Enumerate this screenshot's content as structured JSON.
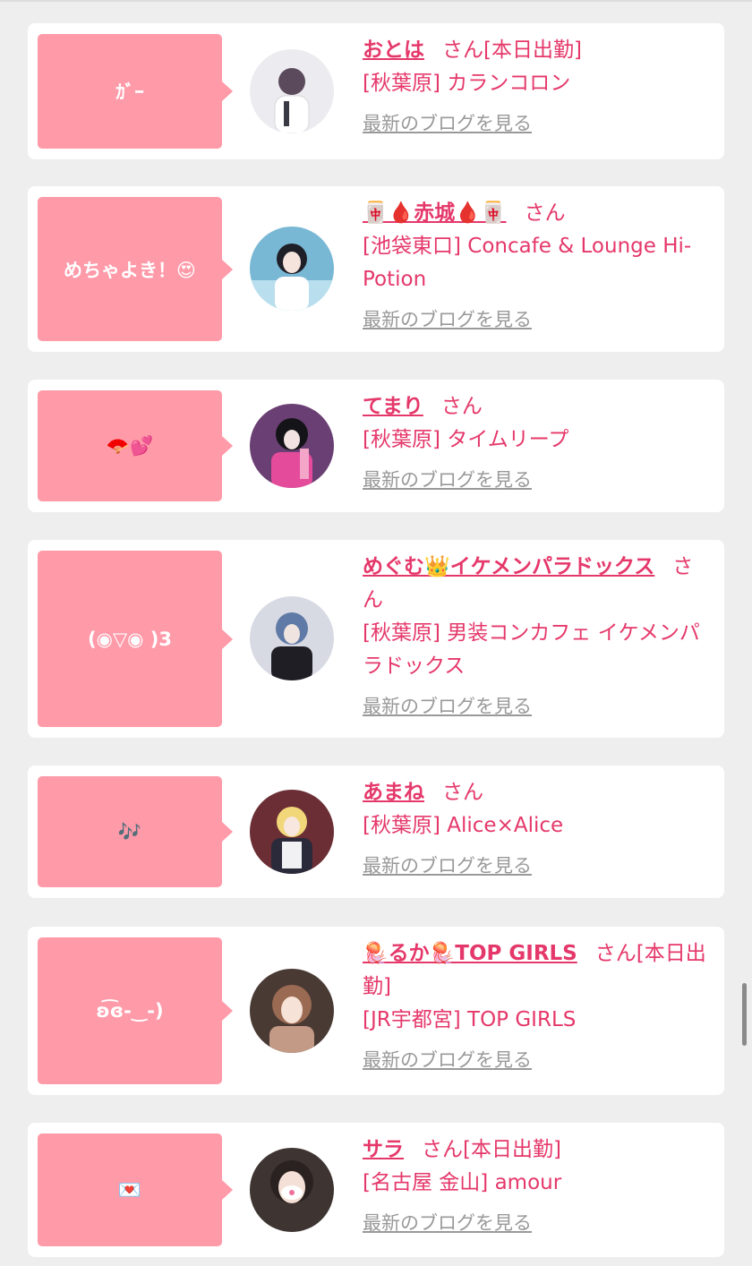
{
  "cards": [
    {
      "bubble": "ｶﾞｰ",
      "name": "おとは",
      "suffix": "さん[本日出勤]",
      "shop": "[秋葉原] カランコロン",
      "blog": "最新のブログを見る",
      "avatar_color": "#e9e6ee"
    },
    {
      "bubble": "めちゃよき！😍",
      "name": "🀄🩸赤城🩸🀄",
      "suffix": "さん",
      "shop": "[池袋東口] Concafe & Lounge Hi-Potion",
      "blog": "最新のブログを見る",
      "avatar_color": "#5fa9c9"
    },
    {
      "bubble": "🪭💕",
      "name": "てまり",
      "suffix": "さん",
      "shop": "[秋葉原] タイムリープ",
      "blog": "最新のブログを見る",
      "avatar_color": "#7b4c8a"
    },
    {
      "bubble": "(◉▽◉ )3",
      "name": "めぐむ👑イケメンパラドックス",
      "suffix": "さん",
      "shop": "[秋葉原] 男装コンカフェ イケメンパラドックス",
      "blog": "最新のブログを見る",
      "avatar_color": "#5a6e93"
    },
    {
      "bubble": "🎶",
      "name": "あまね",
      "suffix": "さん",
      "shop": "[秋葉原] Alice×Alice",
      "blog": "最新のブログを見る",
      "avatar_color": "#7a3a3e"
    },
    {
      "bubble": "ʚ͡ɞ-‿-)",
      "name": "🪼るか🪼TOP GIRLS",
      "suffix": "さん[本日出勤]",
      "shop": "[JR宇都宮] TOP GIRLS",
      "blog": "最新のブログを見る",
      "avatar_color": "#8a5a48"
    },
    {
      "bubble": "💌",
      "name": "サラ",
      "suffix": "さん[本日出勤]",
      "shop": "[名古屋 金山] amour",
      "blog": "最新のブログを見る",
      "avatar_color": "#5b4a45"
    }
  ]
}
